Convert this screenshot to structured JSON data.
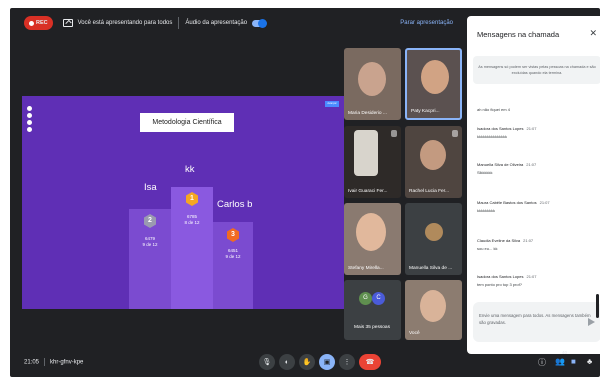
{
  "topbar": {
    "rec_label": "REC",
    "presenting_text": "Você está apresentando para todos",
    "audio_label": "Áudio da apresentação",
    "stop_label": "Parar apresentação"
  },
  "slide": {
    "title": "Metodologia Científica",
    "button_label": "Avançar",
    "players": [
      {
        "name": "Isa",
        "rank": "2",
        "score": "6479",
        "position": "9 de 12"
      },
      {
        "name": "kk",
        "rank": "1",
        "score": "6785",
        "position": "8 de 12"
      },
      {
        "name": "Carlos b",
        "rank": "3",
        "score": "6451",
        "position": "9 de 12"
      }
    ]
  },
  "participants": [
    {
      "name": "Maria Desiderio ..."
    },
    {
      "name": "Paty Kacpri..."
    },
    {
      "name": "Ivair Guaraci Fer..."
    },
    {
      "name": "Rachel Lucia Fer..."
    },
    {
      "name": "Stefany Mirella..."
    },
    {
      "name": "Manuella Silva de ..."
    },
    {
      "name": "Mais 35 pessoas",
      "avatars": [
        "G",
        "C"
      ]
    },
    {
      "name": "Você"
    }
  ],
  "chat": {
    "title": "Mensagens na chamada",
    "notice": "As mensagens só podem ser vistas pelas pessoas na chamada e são excluídas quando ela termina.",
    "messages": [
      {
        "who": "",
        "time": "",
        "text": "ah não fiquei em 4"
      },
      {
        "who": "Isadora dos Santos Lopes",
        "time": "21:07",
        "text": "kkkkkkkkkkkkkkk"
      },
      {
        "who": "Manuella Silva de Oliveira",
        "time": "21:07",
        "text": "Slkkkkkk"
      },
      {
        "who": "Maura Cabêle Bastos dos Santos",
        "time": "21:07",
        "text": "kkkkkkkkk"
      },
      {
        "who": "Claudia Eveline da Silva",
        "time": "21:07",
        "text": "sou eu... kk"
      },
      {
        "who": "Isadora dos Santos Lopes",
        "time": "21:07",
        "text": "tem ponto pro top 3 prof?"
      }
    ],
    "input_placeholder": "Envie uma mensagem para todos. As mensagens também são gravadas."
  },
  "bottombar": {
    "time": "21:05",
    "meeting_code": "khr-gfnv-kpe",
    "participant_count": "40"
  },
  "colors": {
    "slide_bg": "#5f2fb5",
    "rec": "#d93025",
    "end_call": "#ea4335",
    "accent": "#8ab4f8"
  }
}
